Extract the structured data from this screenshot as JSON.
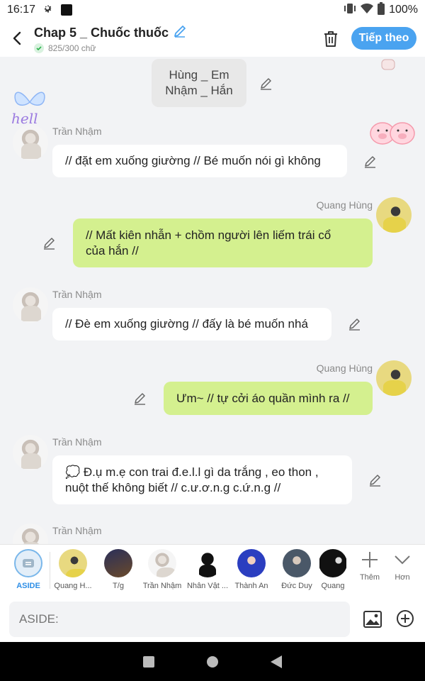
{
  "status_bar": {
    "time": "16:17",
    "battery": "100%"
  },
  "header": {
    "title": "Chap 5 _ Chuốc thuốc",
    "word_count": "825/300 chữ",
    "next_label": "Tiếp theo",
    "accent": "#4aa3f0"
  },
  "chat": {
    "narration": {
      "line1": "Hùng _ Em",
      "line2": "Nhậm _ Hắn"
    },
    "messages": [
      {
        "sender": "Trần Nhậm",
        "side": "left",
        "text": "// đặt em xuống giường // Bé muốn nói gì không"
      },
      {
        "sender": "Quang Hùng",
        "side": "right",
        "line1": "// Mất kiên nhẫn + chồm người lên liếm trái cổ",
        "line2": "của hắn //"
      },
      {
        "sender": "Trần Nhậm",
        "side": "left",
        "text": "// Đè em xuống giường // đấy là bé muốn nhá"
      },
      {
        "sender": "Quang Hùng",
        "side": "right",
        "text": "Ưm~ // tự cởi áo quần mình ra //"
      },
      {
        "sender": "Trần Nhậm",
        "side": "left",
        "line1": "💭 Đ.ụ m.ẹ con trai đ.e.l.l gì da trắng , eo thon ,",
        "line2": "nuột thế không biết // c.ư.ơ.n.g c.ứ.n.g //"
      },
      {
        "sender": "Trần Nhậm",
        "side": "left",
        "text": ""
      }
    ],
    "bubble_green": "#d4f08f"
  },
  "characters": [
    {
      "label": "ASIDE",
      "icon": "aside-icon"
    },
    {
      "label": "Quang H..."
    },
    {
      "label": "T/g"
    },
    {
      "label": "Trần Nhậm"
    },
    {
      "label": "Nhân Vật ..."
    },
    {
      "label": "Thành An"
    },
    {
      "label": "Đức Duy"
    },
    {
      "label": "Quang"
    }
  ],
  "more": {
    "add_label": "Thêm",
    "more_label": "Hơn"
  },
  "input": {
    "placeholder": "ASIDE:"
  },
  "sticker_text": "hell"
}
